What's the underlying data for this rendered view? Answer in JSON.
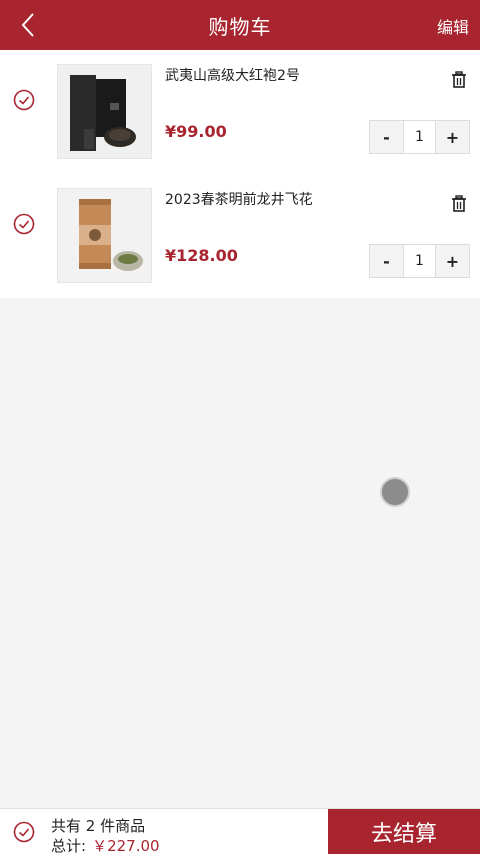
{
  "header": {
    "title": "购物车",
    "edit_label": "编辑"
  },
  "cart": {
    "items": [
      {
        "name": "武夷山高级大红袍2号",
        "price": "¥99.00",
        "quantity": "1",
        "minus_label": "-",
        "plus_label": "+"
      },
      {
        "name": "2023春茶明前龙井飞花",
        "price": "¥128.00",
        "quantity": "1",
        "minus_label": "-",
        "plus_label": "+"
      }
    ]
  },
  "footer": {
    "count_text": "共有 2 件商品",
    "total_label": "总计:",
    "total_amount": "￥227.00",
    "checkout_label": "去结算"
  },
  "colors": {
    "brand": "#a8252f",
    "background": "#f4f4f4"
  }
}
